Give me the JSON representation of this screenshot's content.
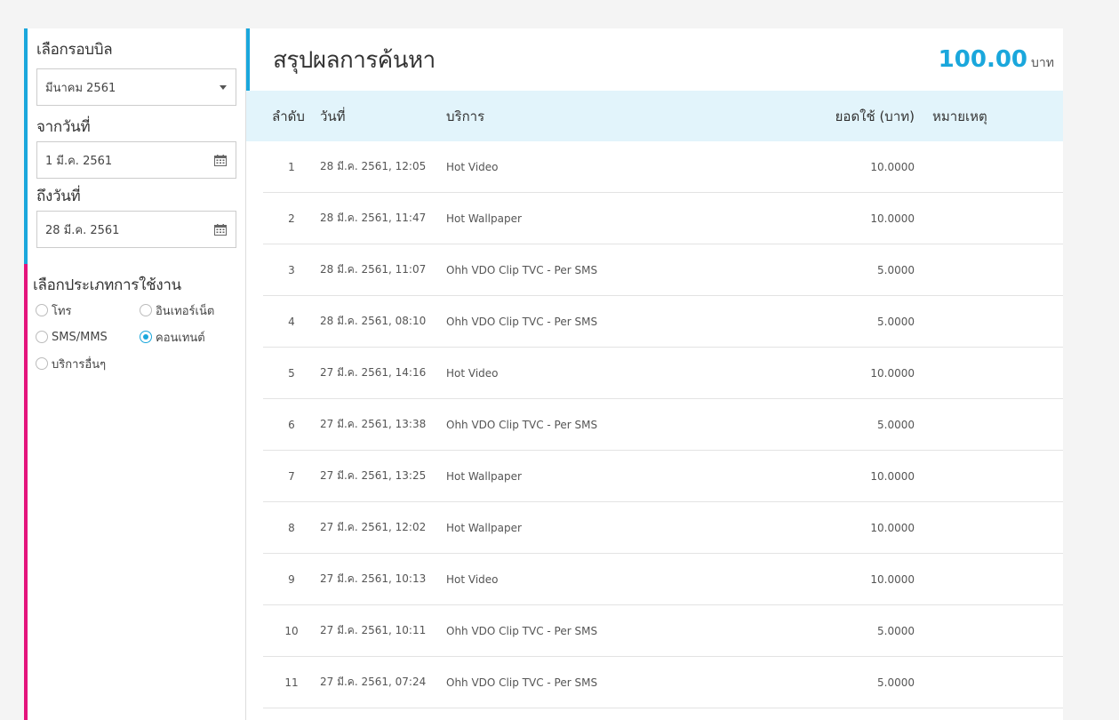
{
  "sidebar": {
    "bill_cycle_label": "เลือกรอบบิล",
    "bill_cycle_value": "มีนาคม 2561",
    "from_date_label": "จากวันที่",
    "from_date_value": "1 มี.ค. 2561",
    "to_date_label": "ถึงวันที่",
    "to_date_value": "28 มี.ค. 2561",
    "usage_type_label": "เลือกประเภทการใช้งาน",
    "usage_types": [
      {
        "label": "โทร",
        "checked": false
      },
      {
        "label": "อินเทอร์เน็ต",
        "checked": false
      },
      {
        "label": "SMS/MMS",
        "checked": false
      },
      {
        "label": "คอนเทนต์",
        "checked": true
      },
      {
        "label": "บริการอื่นๆ",
        "checked": false
      }
    ]
  },
  "summary": {
    "title": "สรุปผลการค้นหา",
    "total_amount": "100.00",
    "total_unit": "บาท"
  },
  "table": {
    "headers": {
      "no": "ลำดับ",
      "date": "วันที่",
      "service": "บริการ",
      "amount": "ยอดใช้ (บาท)",
      "note": "หมายเหตุ"
    },
    "rows": [
      {
        "no": "1",
        "date": "28 มี.ค. 2561, 12:05",
        "service": "Hot Video",
        "amount": "10.0000",
        "note": ""
      },
      {
        "no": "2",
        "date": "28 มี.ค. 2561, 11:47",
        "service": "Hot Wallpaper",
        "amount": "10.0000",
        "note": ""
      },
      {
        "no": "3",
        "date": "28 มี.ค. 2561, 11:07",
        "service": "Ohh VDO Clip TVC - Per SMS",
        "amount": "5.0000",
        "note": ""
      },
      {
        "no": "4",
        "date": "28 มี.ค. 2561, 08:10",
        "service": "Ohh VDO Clip TVC - Per SMS",
        "amount": "5.0000",
        "note": ""
      },
      {
        "no": "5",
        "date": "27 มี.ค. 2561, 14:16",
        "service": "Hot Video",
        "amount": "10.0000",
        "note": ""
      },
      {
        "no": "6",
        "date": "27 มี.ค. 2561, 13:38",
        "service": "Ohh VDO Clip TVC - Per SMS",
        "amount": "5.0000",
        "note": ""
      },
      {
        "no": "7",
        "date": "27 มี.ค. 2561, 13:25",
        "service": "Hot Wallpaper",
        "amount": "10.0000",
        "note": ""
      },
      {
        "no": "8",
        "date": "27 มี.ค. 2561, 12:02",
        "service": "Hot Wallpaper",
        "amount": "10.0000",
        "note": ""
      },
      {
        "no": "9",
        "date": "27 มี.ค. 2561, 10:13",
        "service": "Hot Video",
        "amount": "10.0000",
        "note": ""
      },
      {
        "no": "10",
        "date": "27 มี.ค. 2561, 10:11",
        "service": "Ohh VDO Clip TVC - Per SMS",
        "amount": "5.0000",
        "note": ""
      },
      {
        "no": "11",
        "date": "27 มี.ค. 2561, 07:24",
        "service": "Ohh VDO Clip TVC - Per SMS",
        "amount": "5.0000",
        "note": ""
      }
    ]
  },
  "colors": {
    "accent": "#1aa7dc",
    "magenta": "#e4137b",
    "header_bg": "#e2f4fb"
  },
  "icons": {
    "select": "chevron-down-icon",
    "date": "calendar-icon"
  }
}
